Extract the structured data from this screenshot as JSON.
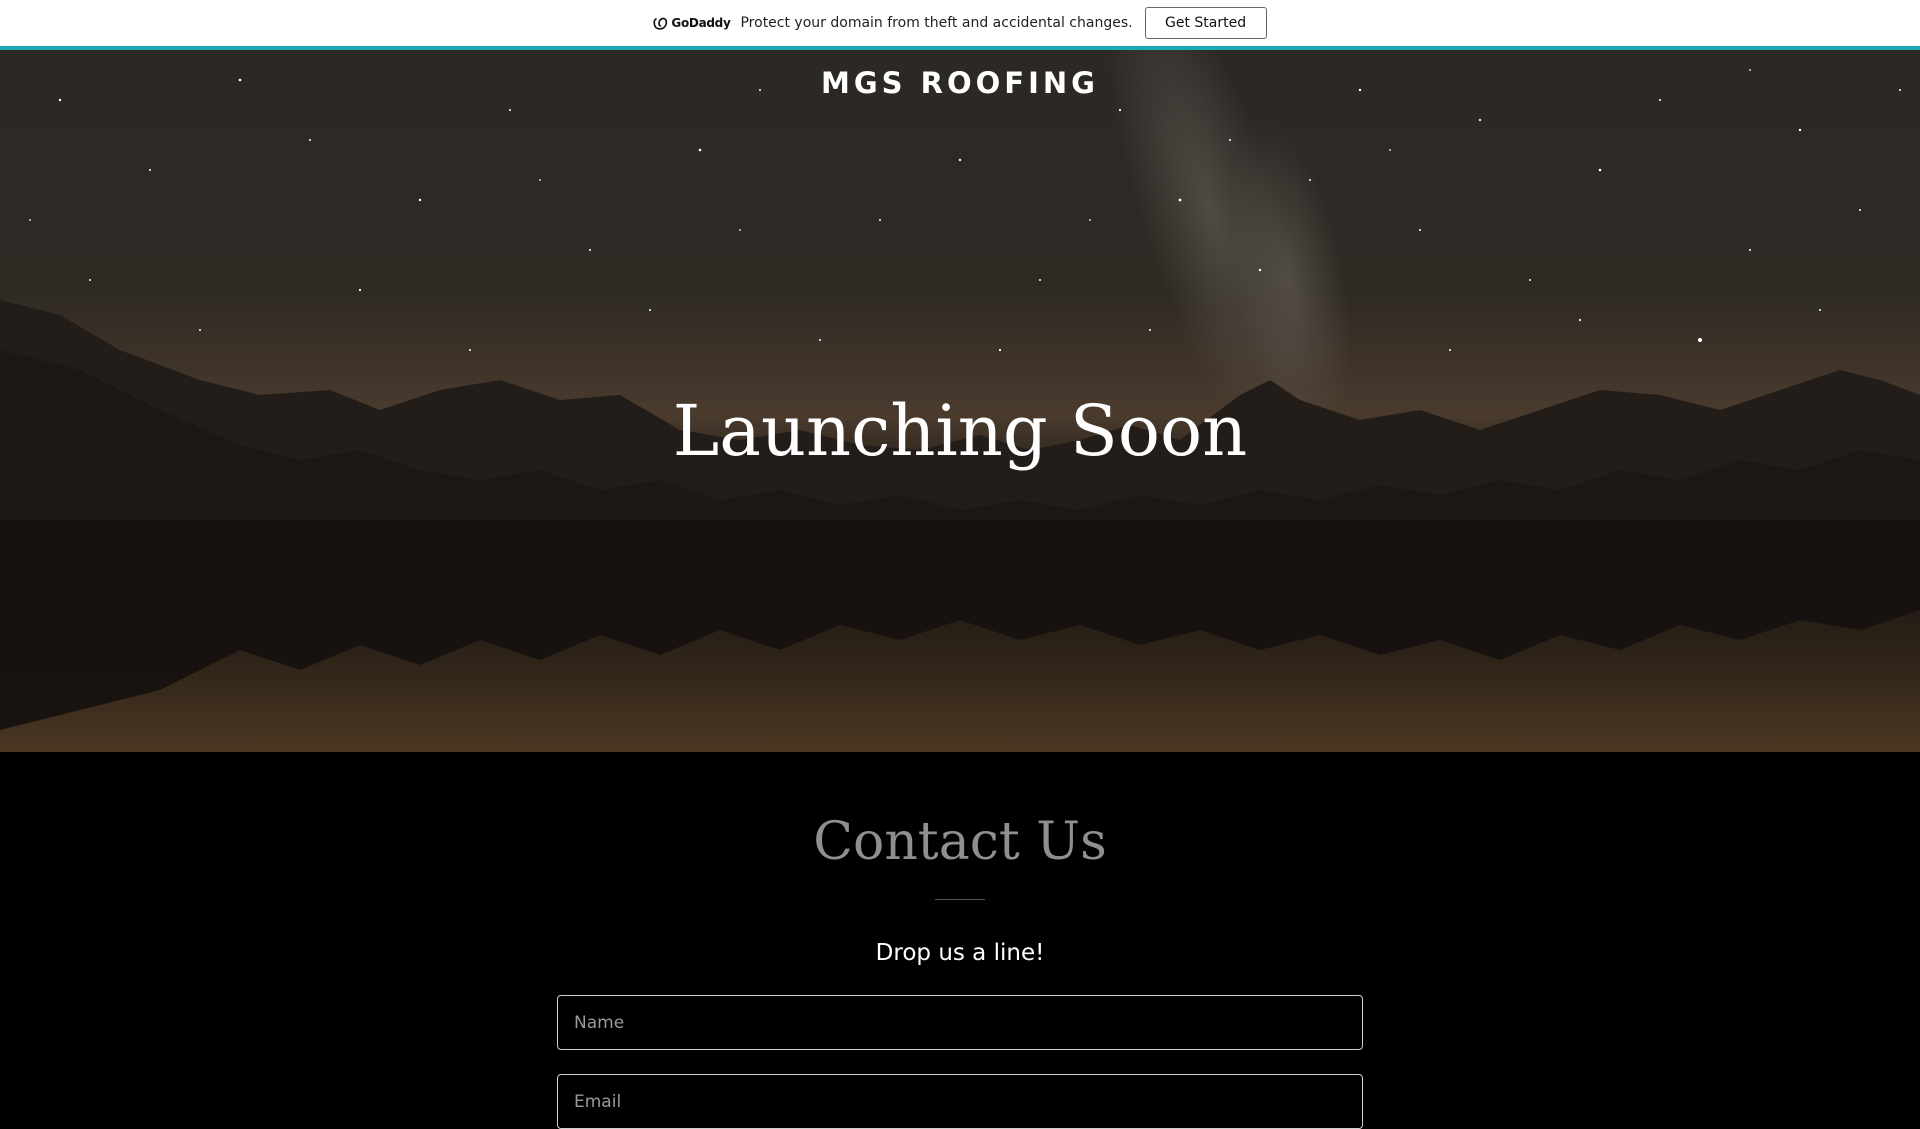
{
  "promo": {
    "logo_text": "GoDaddy",
    "message": "Protect your domain from theft and accidental changes.",
    "cta_label": "Get Started",
    "accent_color": "#1ba9b7"
  },
  "hero": {
    "site_title": "MGS ROOFING",
    "heading": "Launching Soon",
    "background": "night sky over mountains and lake"
  },
  "contact": {
    "heading": "Contact Us",
    "subheading": "Drop us a line!",
    "fields": {
      "name_placeholder": "Name",
      "email_placeholder": "Email"
    }
  }
}
